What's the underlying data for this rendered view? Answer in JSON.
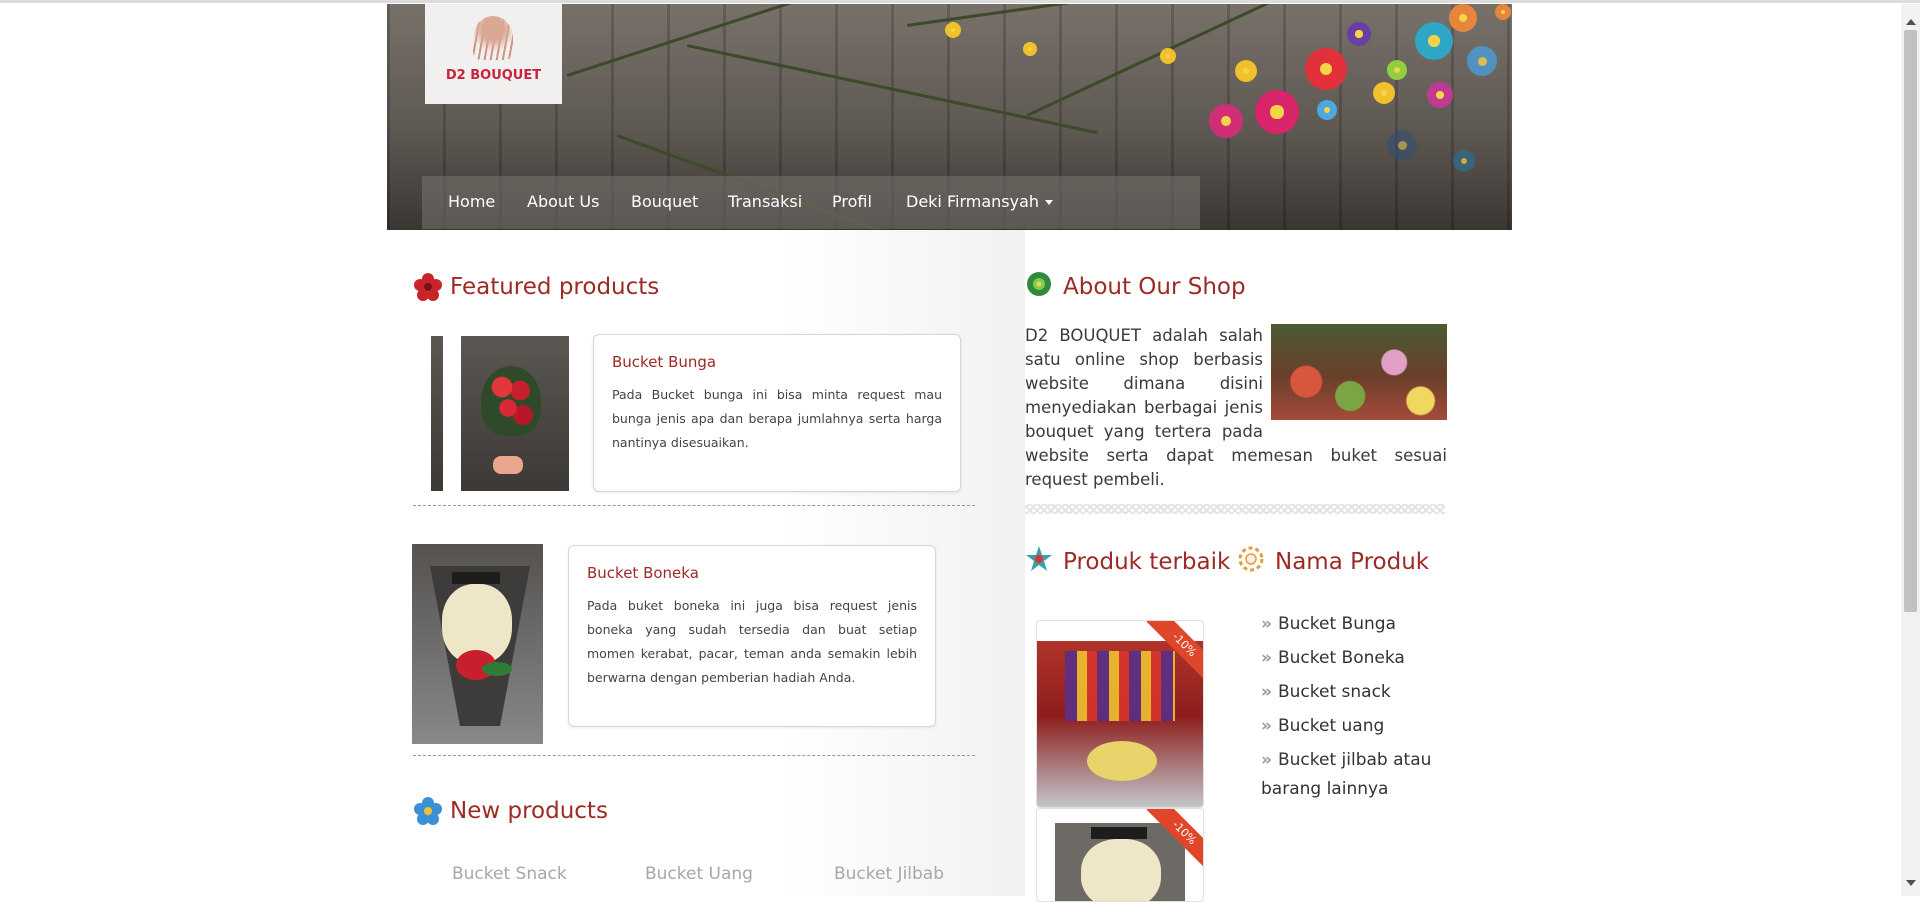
{
  "brand": {
    "logo_text": "D2 BOUQUET"
  },
  "nav": {
    "items": [
      "Home",
      "About Us",
      "Bouquet",
      "Transaksi",
      "Profil"
    ],
    "user_menu": "Deki Firmansyah"
  },
  "featured": {
    "title": "Featured products",
    "products": [
      {
        "name": "Bucket Bunga",
        "description": "Pada Bucket bunga ini bisa minta request mau bunga jenis apa dan berapa jumlahnya serta harga nantinya disesuaikan."
      },
      {
        "name": "Bucket Boneka",
        "description": "Pada buket boneka ini juga bisa request jenis boneka yang sudah tersedia dan buat setiap momen kerabat, pacar, teman anda semakin lebih berwarna dengan pemberian hadiah Anda."
      }
    ]
  },
  "new_products": {
    "title": "New products",
    "items": [
      "Bucket Snack",
      "Bucket Uang",
      "Bucket Jilbab"
    ]
  },
  "about": {
    "title": "About Our Shop",
    "text": "D2 BOUQUET adalah salah satu online shop berbasis website dimana disini menyediakan berbagai jenis bouquet yang tertera pada website serta dapat memesan buket sesuai request pembeli."
  },
  "best": {
    "title": "Produk terbaik",
    "badges": [
      "-10%",
      "-10%"
    ]
  },
  "product_names": {
    "title": "Nama Produk",
    "items": [
      "Bucket Bunga",
      "Bucket Boneka",
      "Bucket snack",
      "Bucket uang",
      "Bucket jilbab atau barang lainnya"
    ]
  },
  "colors": {
    "accent": "#9d2a24",
    "ribbon": "#e0462a"
  }
}
